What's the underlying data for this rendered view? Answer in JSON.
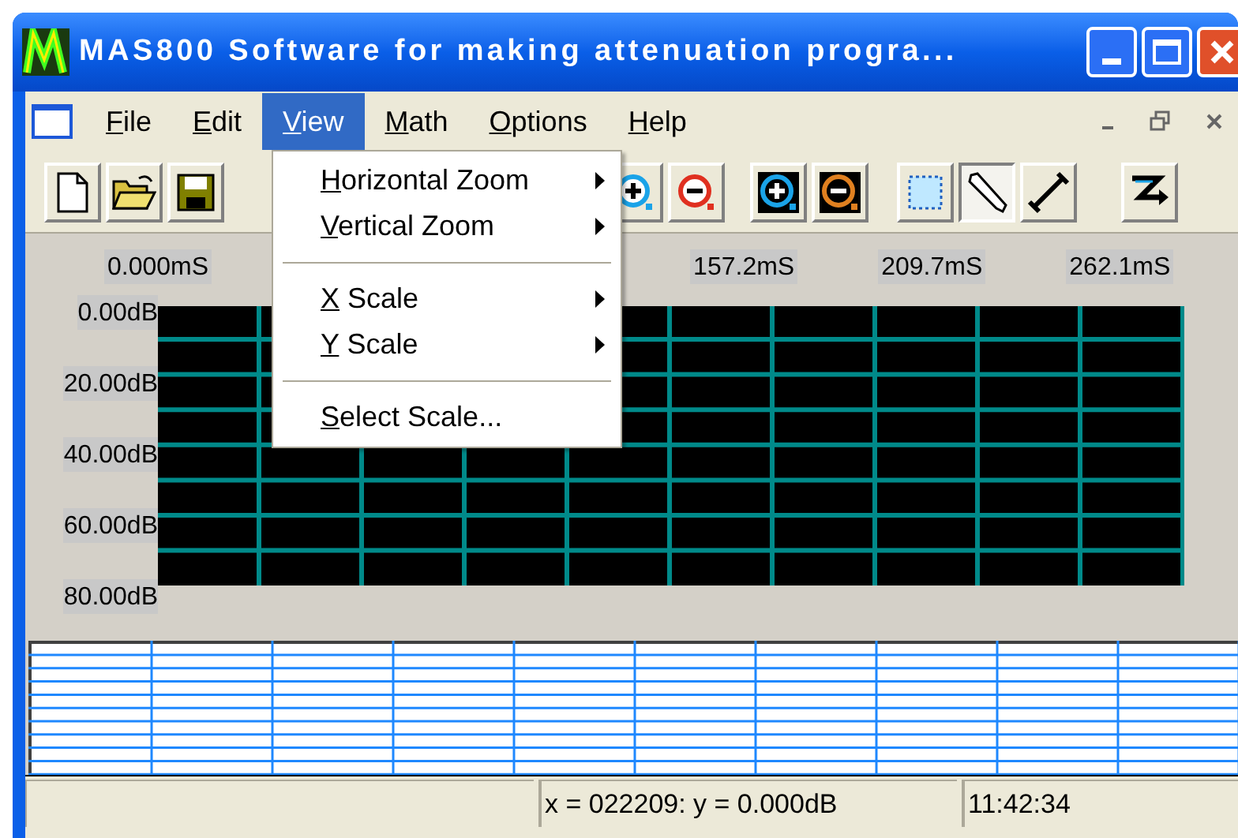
{
  "window": {
    "title": "MAS800 Software for making attenuation progra..."
  },
  "title_buttons": [
    {
      "kind": "minimize"
    },
    {
      "kind": "maximize"
    },
    {
      "kind": "close"
    }
  ],
  "menu_bar": {
    "items": [
      {
        "label": "File",
        "selected": false
      },
      {
        "label": "Edit",
        "selected": false
      },
      {
        "label": "View",
        "selected": true
      },
      {
        "label": "Math",
        "selected": false
      },
      {
        "label": "Options",
        "selected": false
      },
      {
        "label": "Help",
        "selected": false
      }
    ],
    "child_buttons": [
      {
        "kind": "minimize"
      },
      {
        "kind": "restore"
      },
      {
        "kind": "close"
      }
    ]
  },
  "toolbar": [
    {
      "kind": "new",
      "selected": false
    },
    {
      "kind": "open",
      "selected": false
    },
    {
      "kind": "save",
      "selected": false
    },
    {
      "kind": "separator"
    },
    {
      "kind": "zoom-in-h",
      "selected": false
    },
    {
      "kind": "zoom-out-h",
      "selected": false
    },
    {
      "kind": "separator"
    },
    {
      "kind": "zoom-in-y",
      "selected": false
    },
    {
      "kind": "zoom-out-y",
      "selected": false
    },
    {
      "kind": "separator"
    },
    {
      "kind": "select",
      "selected": false
    },
    {
      "kind": "pencil",
      "selected": true
    },
    {
      "kind": "line",
      "selected": false
    },
    {
      "kind": "separator"
    },
    {
      "kind": "jump",
      "selected": false
    }
  ],
  "open_menu": {
    "items": [
      {
        "kind": "item",
        "label": "Horizontal Zoom",
        "submenu": true
      },
      {
        "kind": "item",
        "label": "Vertical Zoom",
        "submenu": true
      },
      {
        "kind": "separator"
      },
      {
        "kind": "item",
        "label": "X Scale",
        "submenu": true
      },
      {
        "kind": "item",
        "label": "Y Scale",
        "submenu": true
      },
      {
        "kind": "separator"
      },
      {
        "kind": "item",
        "label": "Select Scale...",
        "submenu": false
      }
    ]
  },
  "plot": {
    "x_labels": [
      "0.000mS",
      "157.2mS",
      "209.7mS",
      "262.1mS"
    ],
    "y_labels": [
      "0.00dB",
      "20.00dB",
      "40.00dB",
      "60.00dB",
      "80.00dB"
    ]
  },
  "status_bar": {
    "panes": [
      "x = 022209: y = 0.000dB",
      "11:42:34"
    ]
  }
}
